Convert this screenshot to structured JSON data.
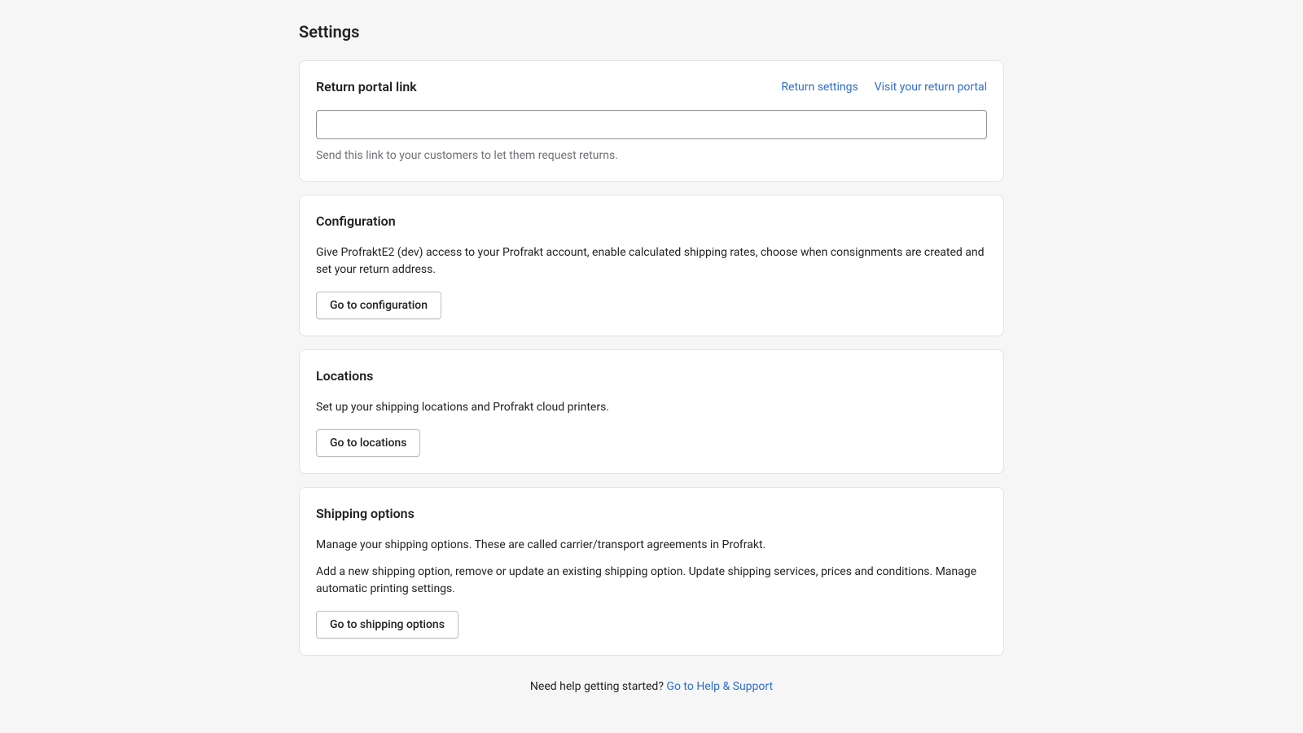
{
  "page": {
    "title": "Settings"
  },
  "return_portal": {
    "title": "Return portal link",
    "return_settings_link": "Return settings",
    "visit_portal_link": "Visit your return portal",
    "input_value": "",
    "helper_text": "Send this link to your customers to let them request returns."
  },
  "configuration": {
    "title": "Configuration",
    "description": "Give ProfraktE2 (dev) access to your Profrakt account, enable calculated shipping rates, choose when consignments are created and set your return address.",
    "button_label": "Go to configuration"
  },
  "locations": {
    "title": "Locations",
    "description": "Set up your shipping locations and Profrakt cloud printers.",
    "button_label": "Go to locations"
  },
  "shipping_options": {
    "title": "Shipping options",
    "description_1": "Manage your shipping options. These are called carrier/transport agreements in Profrakt.",
    "description_2": "Add a new shipping option, remove or update an existing shipping option. Update shipping services, prices and conditions. Manage automatic printing settings.",
    "button_label": "Go to shipping options"
  },
  "footer": {
    "help_prefix": "Need help getting started? ",
    "help_link": "Go to Help & Support"
  }
}
